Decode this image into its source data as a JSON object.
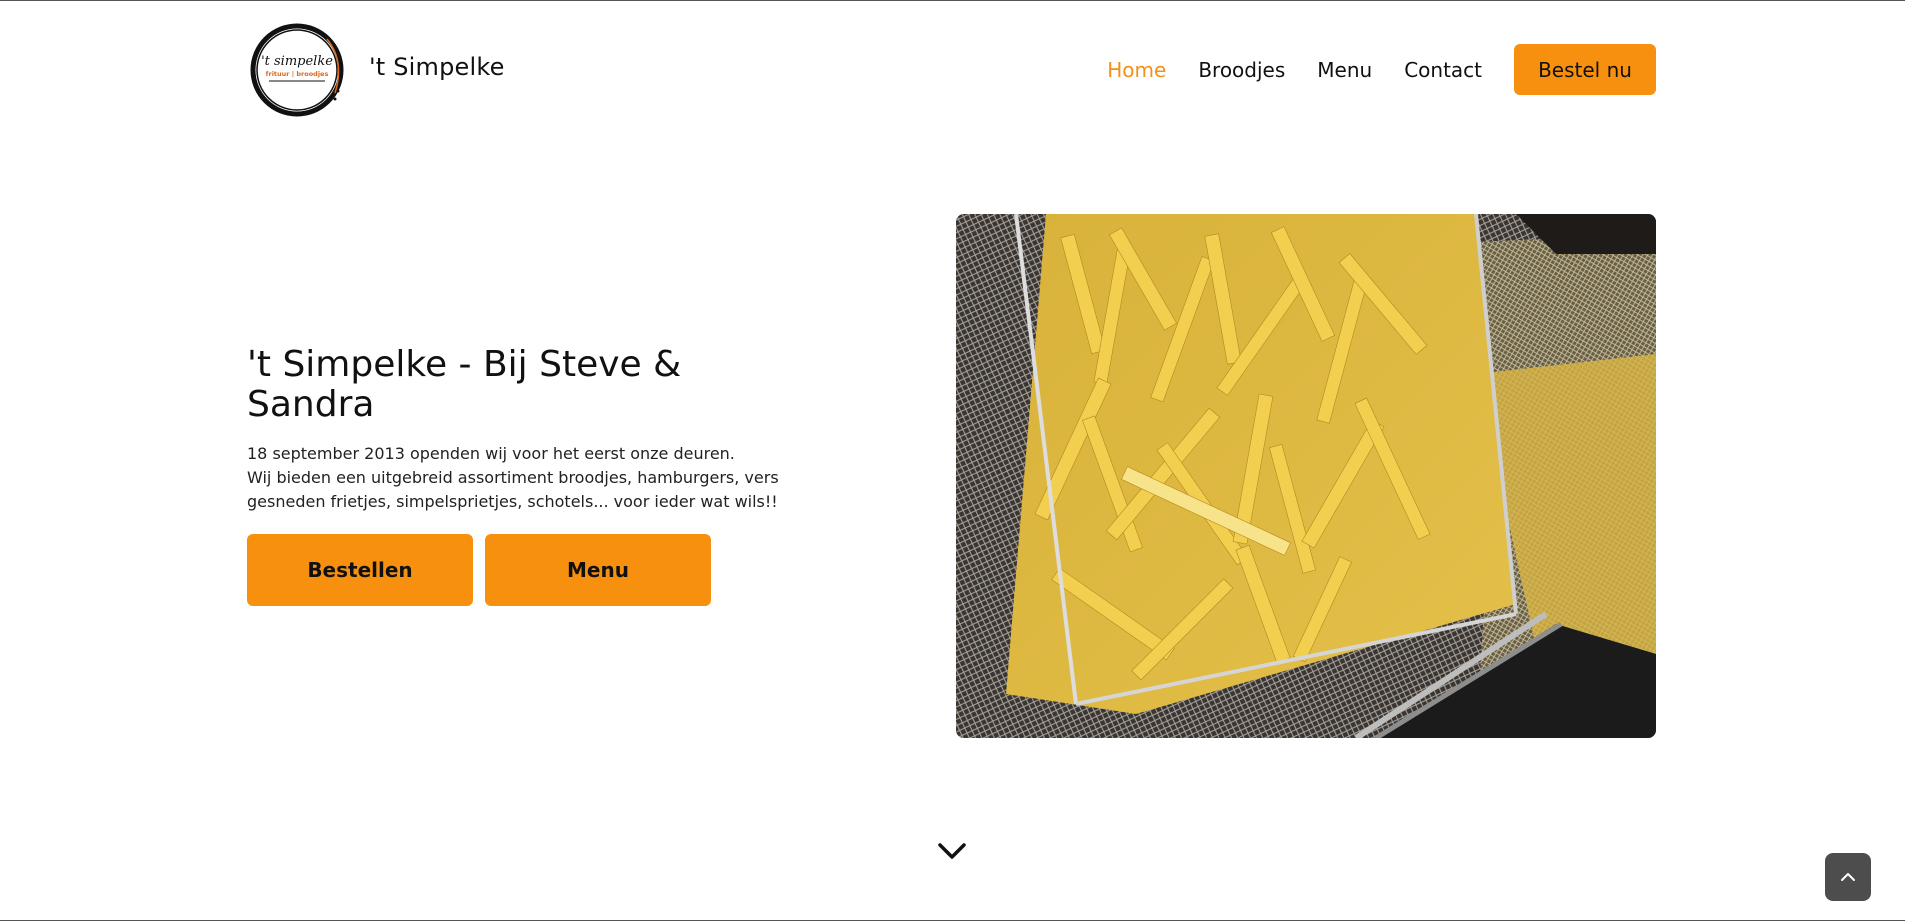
{
  "header": {
    "brand": "'t Simpelke",
    "logo_text": "'t simpelke",
    "logo_sub": "frituur broodjes",
    "nav": [
      {
        "label": "Home",
        "active": true
      },
      {
        "label": "Broodjes",
        "active": false
      },
      {
        "label": "Menu",
        "active": false
      },
      {
        "label": "Contact",
        "active": false
      }
    ],
    "cta_label": "Bestel nu"
  },
  "hero": {
    "title": "'t Simpelke - Bij Steve & Sandra",
    "line1": "18 september 2013 openden wij voor het eerst onze deuren.",
    "line2": "Wij bieden een uitgebreid assortiment broodjes, hamburgers, vers gesneden frietjes, simpelsprietjes, schotels... voor ieder wat wils!!",
    "buttons": {
      "order": "Bestellen",
      "menu": "Menu"
    }
  },
  "icons": {
    "scroll_down": "chevron-down-icon",
    "back_to_top": "chevron-up-icon"
  },
  "colors": {
    "accent": "#f7900f",
    "active_nav": "#f39019",
    "back_to_top_bg": "#4d4d4d"
  }
}
